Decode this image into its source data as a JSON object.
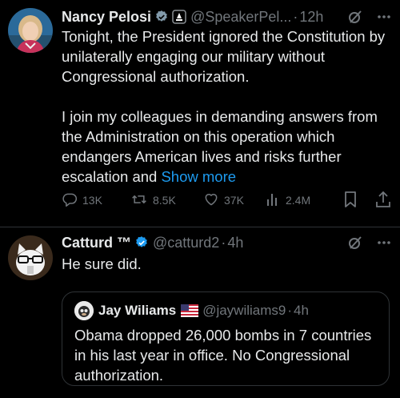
{
  "tweets": [
    {
      "name": "Nancy Pelosi",
      "handle": "@SpeakerPel...",
      "separator": "·",
      "time": "12h",
      "text_1": "Tonight, the President ignored the Constitution by unilaterally engaging our military without Congressional authorization.",
      "text_2": "I join my colleagues in demanding answers from the Administration on this operation which endangers American lives and risks further escalation and ",
      "show_more": "Show more",
      "stats": {
        "replies": "13K",
        "reposts": "8.5K",
        "likes": "37K",
        "views": "2.4M"
      }
    },
    {
      "name": "Catturd ™",
      "handle": "@catturd2",
      "separator": "·",
      "time": "4h",
      "text": "He sure did.",
      "quote": {
        "name": "Jay Wiliams",
        "handle": "@jaywiliams9",
        "separator": "·",
        "time": "4h",
        "text": "Obama dropped 26,000 bombs in 7 countries in his last year in office. No Congressional authorization."
      }
    }
  ],
  "icons": [
    "verified-badge-icon",
    "government-label-icon",
    "grok-icon",
    "more-icon",
    "reply-icon",
    "repost-icon",
    "like-icon",
    "views-icon",
    "bookmark-icon",
    "share-icon",
    "us-flag-icon"
  ],
  "colors": {
    "background": "#000000",
    "text": "#e7e9ea",
    "muted": "#71767b",
    "accent": "#1d9bf0",
    "border": "#2f3336"
  }
}
